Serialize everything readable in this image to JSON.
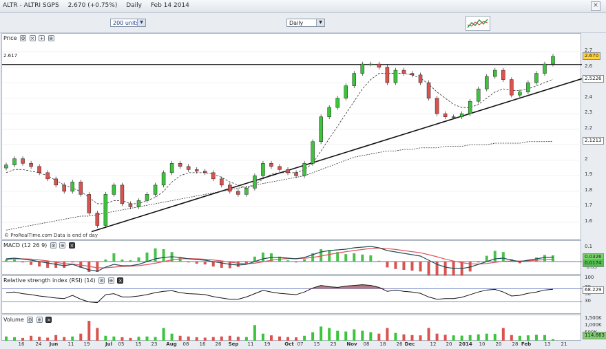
{
  "window": {
    "symbol": "ALTR - ALTRI SGPS",
    "last": "2.670 (+0.75%)",
    "period": "Daily",
    "date": "Feb 14 2014"
  },
  "toolbar": {
    "units": "200 units",
    "period": "Daily"
  },
  "price_panel": {
    "label": "Price",
    "hline_label": "2.617",
    "ticks": [
      "2.7",
      "2.6",
      "2.5",
      "2.4",
      "2.3",
      "2.2",
      "2.1",
      "2",
      "1.9",
      "1.8",
      "1.7",
      "1.6"
    ],
    "tags": {
      "last": "2.670",
      "ma_short": "2.5226",
      "ma_long": "2.1213"
    },
    "footnote": "© ProRealTime.com  Data is end of day"
  },
  "macd_panel": {
    "label": "MACD (12 26 9)",
    "ticks": [
      "0.1",
      "0",
      "-0.05"
    ],
    "tags": {
      "a": "0.0326",
      "b": "0.0174"
    }
  },
  "rsi_panel": {
    "label": "Relative strength index (RSI) (14)",
    "ticks": [
      "100",
      "70",
      "50",
      "30"
    ],
    "tags": {
      "value": "68.229"
    }
  },
  "volume_panel": {
    "label": "Volume",
    "ticks": [
      "1,500K",
      "1,000K",
      "500K"
    ],
    "tags": {
      "value": "114.663"
    }
  },
  "xaxis": [
    {
      "t": "16",
      "x": 29
    },
    {
      "t": "24",
      "x": 54
    },
    {
      "t": "Jun",
      "x": 76,
      "b": true
    },
    {
      "t": "11",
      "x": 101
    },
    {
      "t": "19",
      "x": 124
    },
    {
      "t": "Jul",
      "x": 156,
      "b": true
    },
    {
      "t": "05",
      "x": 174
    },
    {
      "t": "15",
      "x": 199
    },
    {
      "t": "23",
      "x": 222
    },
    {
      "t": "Aug",
      "x": 247,
      "b": true
    },
    {
      "t": "08",
      "x": 268
    },
    {
      "t": "16",
      "x": 292
    },
    {
      "t": "26",
      "x": 315
    },
    {
      "t": "Sep",
      "x": 337,
      "b": true
    },
    {
      "t": "11",
      "x": 362
    },
    {
      "t": "19",
      "x": 386
    },
    {
      "t": "Oct",
      "x": 418,
      "b": true
    },
    {
      "t": "07",
      "x": 434
    },
    {
      "t": "15",
      "x": 458
    },
    {
      "t": "23",
      "x": 482
    },
    {
      "t": "Nov",
      "x": 509,
      "b": true
    },
    {
      "t": "08",
      "x": 530
    },
    {
      "t": "18",
      "x": 554
    },
    {
      "t": "26",
      "x": 578
    },
    {
      "t": "Dec",
      "x": 593,
      "b": true
    },
    {
      "t": "12",
      "x": 627
    },
    {
      "t": "20",
      "x": 650
    },
    {
      "t": "2014",
      "x": 674,
      "b": true
    },
    {
      "t": "10",
      "x": 698
    },
    {
      "t": "20",
      "x": 722
    },
    {
      "t": "28",
      "x": 746
    },
    {
      "t": "Feb",
      "x": 762,
      "b": true
    },
    {
      "t": "13",
      "x": 793
    },
    {
      "t": "21",
      "x": 817
    }
  ],
  "chart_data": {
    "type": "line",
    "series": [
      {
        "name": "Price",
        "values": [
          1.97,
          2.01,
          1.98,
          1.96,
          1.92,
          1.88,
          1.84,
          1.8,
          1.86,
          1.78,
          1.66,
          1.58,
          1.78,
          1.84,
          1.72,
          1.7,
          1.74,
          1.78,
          1.84,
          1.92,
          1.98,
          1.96,
          1.94,
          1.93,
          1.92,
          1.88,
          1.84,
          1.8,
          1.78,
          1.82,
          1.9,
          1.98,
          1.96,
          1.94,
          1.92,
          1.9,
          1.98,
          2.12,
          2.28,
          2.34,
          2.4,
          2.48,
          2.56,
          2.62,
          2.62,
          2.6,
          2.5,
          2.58,
          2.56,
          2.55,
          2.5,
          2.4,
          2.3,
          2.28,
          2.28,
          2.3,
          2.38,
          2.46,
          2.54,
          2.58,
          2.52,
          2.42,
          2.44,
          2.5,
          2.56,
          2.62,
          2.67
        ]
      },
      {
        "name": "MA short",
        "values": [
          1.92,
          1.94,
          1.94,
          1.93,
          1.92,
          1.9,
          1.87,
          1.84,
          1.82,
          1.8,
          1.76,
          1.72,
          1.72,
          1.74,
          1.74,
          1.72,
          1.72,
          1.74,
          1.76,
          1.8,
          1.86,
          1.9,
          1.92,
          1.92,
          1.92,
          1.91,
          1.89,
          1.86,
          1.84,
          1.82,
          1.84,
          1.88,
          1.91,
          1.92,
          1.92,
          1.92,
          1.94,
          1.98,
          2.06,
          2.14,
          2.22,
          2.3,
          2.38,
          2.46,
          2.52,
          2.56,
          2.56,
          2.56,
          2.56,
          2.55,
          2.53,
          2.49,
          2.44,
          2.4,
          2.36,
          2.34,
          2.34,
          2.36,
          2.4,
          2.44,
          2.46,
          2.45,
          2.45,
          2.46,
          2.48,
          2.5,
          2.5226
        ]
      },
      {
        "name": "MA long",
        "values": [
          1.55,
          1.56,
          1.57,
          1.58,
          1.59,
          1.6,
          1.61,
          1.62,
          1.63,
          1.64,
          1.64,
          1.65,
          1.66,
          1.67,
          1.68,
          1.69,
          1.7,
          1.71,
          1.72,
          1.73,
          1.74,
          1.75,
          1.76,
          1.77,
          1.78,
          1.79,
          1.8,
          1.81,
          1.82,
          1.83,
          1.84,
          1.85,
          1.86,
          1.87,
          1.88,
          1.89,
          1.9,
          1.92,
          1.94,
          1.96,
          1.98,
          2.0,
          2.02,
          2.03,
          2.04,
          2.05,
          2.06,
          2.06,
          2.07,
          2.07,
          2.08,
          2.08,
          2.08,
          2.09,
          2.09,
          2.09,
          2.1,
          2.1,
          2.1,
          2.11,
          2.11,
          2.11,
          2.11,
          2.12,
          2.12,
          2.12,
          2.1213
        ]
      }
    ],
    "ylim": [
      1.52,
      2.78
    ],
    "hline": 2.617,
    "trendline": [
      [
        1.54,
        0
      ],
      [
        2.49,
        66
      ]
    ],
    "macd": {
      "line": [
        0.02,
        0.025,
        0.018,
        0.01,
        0.0,
        -0.01,
        -0.02,
        -0.03,
        -0.02,
        -0.04,
        -0.06,
        -0.07,
        -0.04,
        -0.02,
        -0.03,
        -0.03,
        -0.02,
        0.0,
        0.02,
        0.03,
        0.035,
        0.03,
        0.02,
        0.015,
        0.01,
        0.0,
        -0.01,
        -0.02,
        -0.025,
        -0.02,
        0.0,
        0.02,
        0.03,
        0.03,
        0.025,
        0.02,
        0.03,
        0.05,
        0.07,
        0.08,
        0.085,
        0.09,
        0.1,
        0.105,
        0.11,
        0.1,
        0.08,
        0.07,
        0.06,
        0.05,
        0.04,
        0.01,
        -0.02,
        -0.04,
        -0.05,
        -0.05,
        -0.04,
        -0.02,
        0.0,
        0.02,
        0.025,
        0.01,
        0.0,
        0.01,
        0.02,
        0.03,
        0.0326
      ],
      "signal": [
        0.015,
        0.02,
        0.02,
        0.018,
        0.012,
        0.005,
        -0.005,
        -0.015,
        -0.018,
        -0.025,
        -0.035,
        -0.045,
        -0.045,
        -0.04,
        -0.035,
        -0.033,
        -0.03,
        -0.022,
        -0.012,
        0.0,
        0.012,
        0.02,
        0.022,
        0.02,
        0.017,
        0.012,
        0.005,
        -0.004,
        -0.012,
        -0.016,
        -0.012,
        -0.002,
        0.01,
        0.018,
        0.022,
        0.022,
        0.024,
        0.03,
        0.04,
        0.052,
        0.062,
        0.072,
        0.08,
        0.088,
        0.095,
        0.098,
        0.094,
        0.088,
        0.08,
        0.072,
        0.064,
        0.05,
        0.035,
        0.018,
        0.004,
        -0.008,
        -0.016,
        -0.018,
        -0.014,
        -0.006,
        0.002,
        0.004,
        0.004,
        0.006,
        0.01,
        0.014,
        0.0174
      ],
      "ylim": [
        -0.08,
        0.12
      ]
    },
    "rsi": {
      "values": [
        58,
        60,
        55,
        52,
        48,
        45,
        42,
        40,
        50,
        38,
        30,
        28,
        52,
        55,
        45,
        45,
        48,
        52,
        58,
        62,
        64,
        58,
        55,
        54,
        52,
        46,
        42,
        38,
        38,
        45,
        55,
        65,
        60,
        56,
        54,
        52,
        60,
        72,
        80,
        76,
        74,
        78,
        80,
        82,
        80,
        74,
        62,
        66,
        62,
        60,
        56,
        45,
        38,
        40,
        40,
        44,
        52,
        60,
        66,
        68,
        60,
        48,
        50,
        56,
        60,
        66,
        68.229
      ],
      "ylim": [
        0,
        100
      ]
    },
    "volume": {
      "values": [
        300,
        250,
        200,
        350,
        280,
        220,
        400,
        260,
        300,
        500,
        1400,
        900,
        350,
        300,
        250,
        200,
        280,
        300,
        260,
        900,
        500,
        350,
        300,
        250,
        220,
        260,
        300,
        350,
        280,
        260,
        1100,
        500,
        380,
        300,
        260,
        240,
        350,
        600,
        1000,
        900,
        700,
        650,
        800,
        700,
        600,
        500,
        900,
        550,
        450,
        400,
        380,
        900,
        500,
        420,
        380,
        360,
        400,
        450,
        500,
        480,
        900,
        400,
        350,
        380,
        420,
        400,
        114.663
      ],
      "ylim": [
        0,
        1600
      ]
    }
  }
}
